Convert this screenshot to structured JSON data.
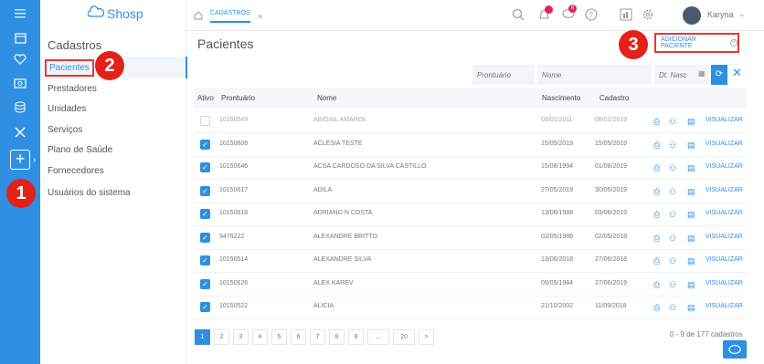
{
  "app": {
    "logo_text": "Shosp"
  },
  "rail": {
    "icons": [
      "menu-icon",
      "calendar-icon",
      "heart-icon",
      "money-icon",
      "database-icon",
      "tools-icon"
    ],
    "add_label": "+"
  },
  "sidebar": {
    "title": "Cadastros",
    "items": [
      {
        "label": "Pacientes"
      },
      {
        "label": "Prestadores"
      },
      {
        "label": "Unidades"
      },
      {
        "label": "Serviços"
      },
      {
        "label": "Plano de Saúde"
      },
      {
        "label": "Fornecedores"
      },
      {
        "label": "Usuários do sistema"
      }
    ]
  },
  "topbar": {
    "tab_label": "CADASTROS",
    "notification_badge": "",
    "chat_badge": "6",
    "user_name": "Karyna"
  },
  "main": {
    "title": "Pacientes",
    "add_button": "ADICIONAR PACIENTE"
  },
  "filters": {
    "prontuario_placeholder": "Prontuário",
    "nome_placeholder": "Nome",
    "dtnasc_placeholder": "Dt. Nasc"
  },
  "table": {
    "headers": {
      "ativo": "Ativo",
      "prontuario": "Prontuário",
      "nome": "Nome",
      "nascimento": "Nascimento",
      "cadastro": "Cadastro"
    },
    "action_label": "VISUALIZAR",
    "rows": [
      {
        "active": false,
        "prontuario": "10150549",
        "nome": "ABIGAIL AMAROL",
        "nascimento": "08/01/2011",
        "cadastro": "08/01/2019"
      },
      {
        "active": true,
        "prontuario": "10150608",
        "nome": "ACLÉSIA TESTE",
        "nascimento": "15/05/2019",
        "cadastro": "15/05/2019"
      },
      {
        "active": true,
        "prontuario": "10150646",
        "nome": "ACSA CARDOSO DA SILVA CASTILLO",
        "nascimento": "15/08/1994",
        "cadastro": "01/08/2019"
      },
      {
        "active": true,
        "prontuario": "10150617",
        "nome": "ADILA",
        "nascimento": "27/05/2019",
        "cadastro": "30/05/2019"
      },
      {
        "active": true,
        "prontuario": "10150618",
        "nome": "ADRIANO N COSTA",
        "nascimento": "13/06/1988",
        "cadastro": "03/06/2019"
      },
      {
        "active": true,
        "prontuario": "9476222",
        "nome": "ALEXANDRE BRITTO",
        "nascimento": "02/05/1986",
        "cadastro": "02/05/2018"
      },
      {
        "active": true,
        "prontuario": "10150514",
        "nome": "ALEXANDRE SILVA",
        "nascimento": "13/06/2018",
        "cadastro": "27/06/2018"
      },
      {
        "active": true,
        "prontuario": "10150626",
        "nome": "ALEX KAREV",
        "nascimento": "09/05/1984",
        "cadastro": "27/06/2019"
      },
      {
        "active": true,
        "prontuario": "10150522",
        "nome": "ALICIA",
        "nascimento": "21/10/2002",
        "cadastro": "11/09/2018"
      }
    ]
  },
  "pagination": {
    "pages": [
      "1",
      "2",
      "3",
      "4",
      "5",
      "6",
      "7",
      "8",
      "9",
      "...",
      "20",
      ">"
    ],
    "count_text": "0 - 9 de 177 cadastros"
  },
  "markers": [
    "1",
    "2",
    "3"
  ],
  "colors": {
    "accent": "#2f8fe3",
    "marker": "#e32118",
    "highlight_border": "#e53935"
  }
}
